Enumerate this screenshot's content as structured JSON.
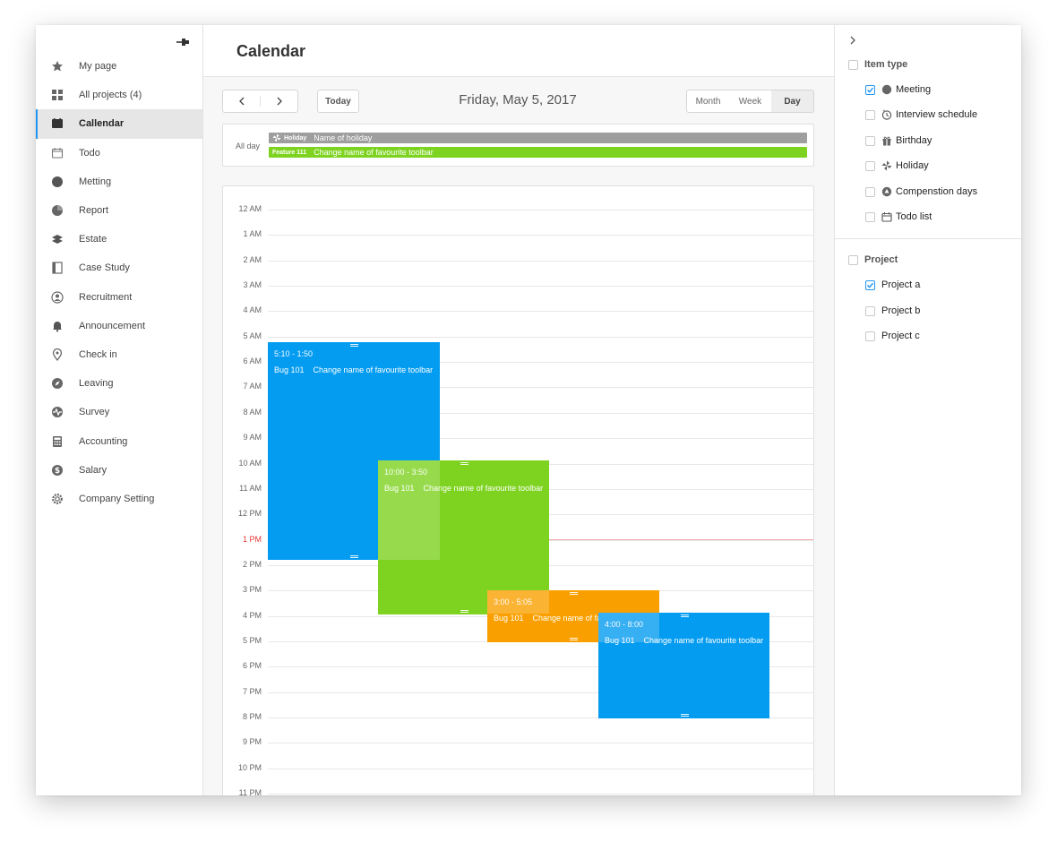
{
  "sidebar": {
    "items": [
      {
        "label": "My page",
        "icon": "star-icon"
      },
      {
        "label": "All projects (4)",
        "icon": "grid-icon"
      },
      {
        "label": "Callendar",
        "icon": "calendar-icon",
        "active": true
      },
      {
        "label": "Todo",
        "icon": "todo-icon"
      },
      {
        "label": "Metting",
        "icon": "chat-bubble-icon"
      },
      {
        "label": "Report",
        "icon": "pie-chart-icon"
      },
      {
        "label": "Estate",
        "icon": "layers-icon"
      },
      {
        "label": "Case Study",
        "icon": "book-icon"
      },
      {
        "label": "Recruitment",
        "icon": "user-circle-icon"
      },
      {
        "label": "Announcement",
        "icon": "bell-icon"
      },
      {
        "label": "Check in",
        "icon": "map-pin-icon"
      },
      {
        "label": "Leaving",
        "icon": "compass-icon"
      },
      {
        "label": "Survey",
        "icon": "pulse-icon"
      },
      {
        "label": "Accounting",
        "icon": "calculator-icon"
      },
      {
        "label": "Salary",
        "icon": "dollar-icon"
      },
      {
        "label": "Company Setting",
        "icon": "gear-icon"
      }
    ]
  },
  "main": {
    "title": "Calendar",
    "today_label": "Today",
    "date_title": "Friday, May 5, 2017",
    "views": [
      "Month",
      "Week",
      "Day"
    ],
    "active_view": "Day",
    "allday": {
      "label": "All day",
      "holiday": {
        "tag": "Holiday",
        "text": "Name of holiday"
      },
      "feature": {
        "tag": "Feature 111",
        "text": "Change name of favourite toolbar"
      }
    },
    "hours": [
      "12 AM",
      "1 AM",
      "2 AM",
      "3 AM",
      "4 AM",
      "5 AM",
      "6 AM",
      "7 AM",
      "8 AM",
      "9 AM",
      "10 AM",
      "11 AM",
      "12 PM",
      "1 PM",
      "2 PM",
      "3 PM",
      "4 PM",
      "5 PM",
      "6 PM",
      "7 PM",
      "8 PM",
      "9 PM",
      "10 PM",
      "11 PM"
    ],
    "current_hour": "1 PM",
    "events": [
      {
        "time": "5:10 - 1:50",
        "bug": "Bug 101",
        "title": "Change name of favourite toolbar",
        "color": "#049cf1"
      },
      {
        "time": "10:00 - 3:50",
        "bug": "Bug 101",
        "title": "Change name of favourite toolbar",
        "color": "#7ed321"
      },
      {
        "time": "3:00 - 5:05",
        "bug": "Bug 101",
        "title": "Change name of favourite toolbar",
        "color": "#f9a000"
      },
      {
        "time": "4:00 - 8:00",
        "bug": "Bug 101",
        "title": "Change name of favourite toolbar",
        "color": "#049cf1"
      }
    ]
  },
  "filters": {
    "item_type": {
      "title": "Item type",
      "items": [
        {
          "label": "Meeting",
          "checked": true,
          "icon": "meeting-dot-icon"
        },
        {
          "label": "Interview schedule",
          "checked": false,
          "icon": "clock-icon"
        },
        {
          "label": "Birthday",
          "checked": false,
          "icon": "gift-icon"
        },
        {
          "label": "Holiday",
          "checked": false,
          "icon": "pinwheel-icon"
        },
        {
          "label": "Compenstion days",
          "checked": false,
          "icon": "aperture-icon"
        },
        {
          "label": "Todo list",
          "checked": false,
          "icon": "calendar-small-icon"
        }
      ]
    },
    "project": {
      "title": "Project",
      "items": [
        {
          "label": "Project a",
          "checked": true
        },
        {
          "label": "Project b",
          "checked": false
        },
        {
          "label": "Project c",
          "checked": false
        }
      ]
    }
  },
  "colors": {
    "accent": "#2196f3",
    "event_blue": "#049cf1",
    "event_green": "#7ed321",
    "event_orange": "#f9a000",
    "holiday_gray": "#9e9e9e",
    "now_red": "#e53935"
  }
}
